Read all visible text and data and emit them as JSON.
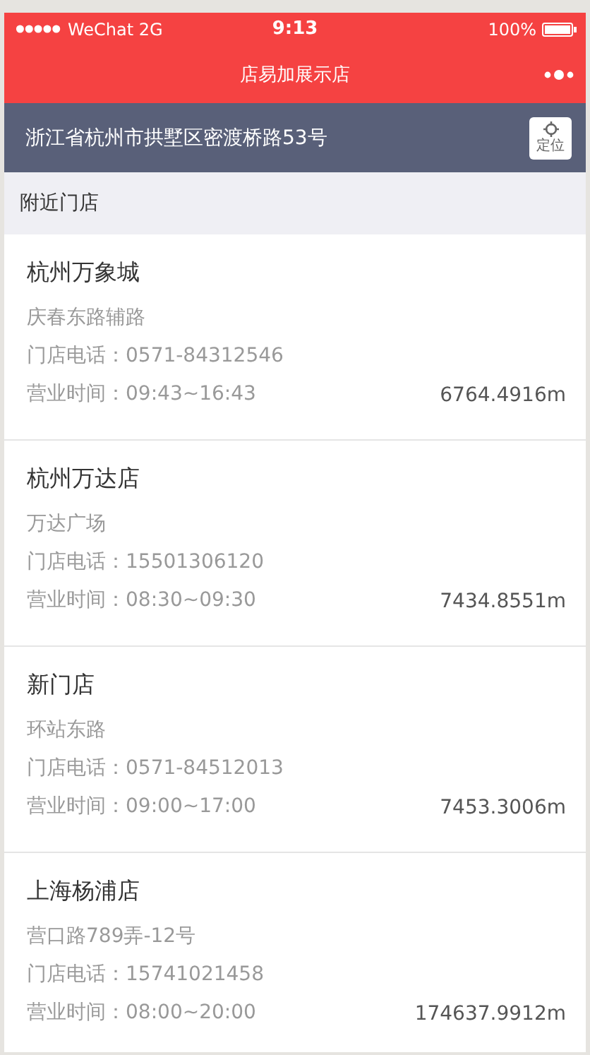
{
  "status_bar": {
    "carrier": "WeChat 2G",
    "time": "9:13",
    "battery": "100%"
  },
  "nav": {
    "title": "店易加展示店"
  },
  "location": {
    "address": "浙江省杭州市拱墅区密渡桥路53号",
    "button": "定位"
  },
  "section": {
    "title": "附近门店"
  },
  "stores": [
    {
      "name": "杭州万象城",
      "address": "庆春东路辅路",
      "phone": "门店电话：0571-84312546",
      "hours": "营业时间：09:43~16:43",
      "distance": "6764.4916m"
    },
    {
      "name": "杭州万达店",
      "address": "万达广场",
      "phone": "门店电话：15501306120",
      "hours": "营业时间：08:30~09:30",
      "distance": "7434.8551m"
    },
    {
      "name": "新门店",
      "address": "环站东路",
      "phone": "门店电话：0571-84512013",
      "hours": "营业时间：09:00~17:00",
      "distance": "7453.3006m"
    },
    {
      "name": "上海杨浦店",
      "address": "营口路789弄-12号",
      "phone": "门店电话：15741021458",
      "hours": "营业时间：08:00~20:00",
      "distance": "174637.9912m"
    }
  ]
}
